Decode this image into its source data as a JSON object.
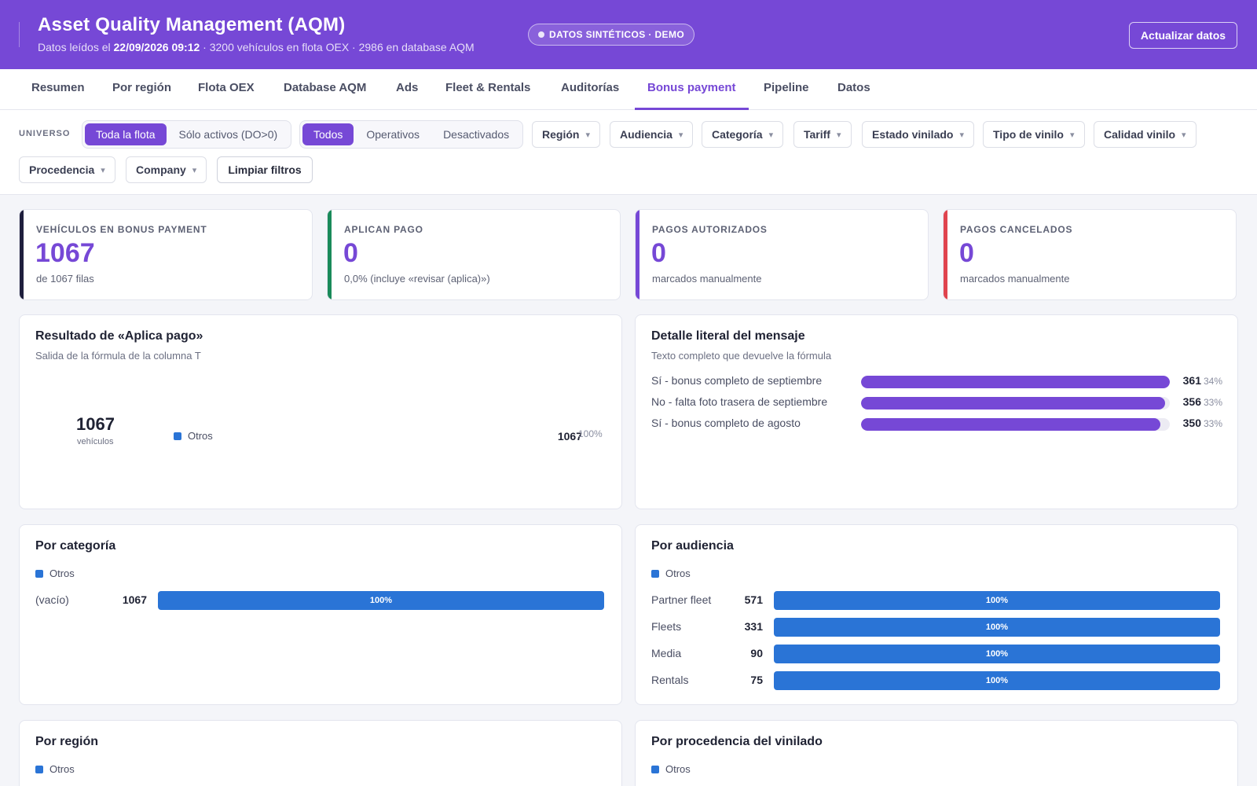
{
  "header": {
    "title": "Asset Quality Management (AQM)",
    "subtitle_prefix": "Datos leídos el",
    "subtitle_date": "22/09/2026 09:12",
    "subtitle_suffix": "· 3200 vehículos en flota OEX · 2986 en database AQM",
    "demo_badge": "DATOS SINTÉTICOS · DEMO",
    "refresh_button": "Actualizar datos"
  },
  "tabs": [
    {
      "label": "Resumen"
    },
    {
      "label": "Por región"
    },
    {
      "label": "Flota OEX"
    },
    {
      "label": "Database AQM"
    },
    {
      "label": "Ads"
    },
    {
      "label": "Fleet & Rentals"
    },
    {
      "label": "Auditorías"
    },
    {
      "label": "Bonus payment",
      "active": true
    },
    {
      "label": "Pipeline"
    },
    {
      "label": "Datos"
    }
  ],
  "filters": {
    "universe_label": "UNIVERSO",
    "universe_options": [
      "Toda la flota",
      "Sólo activos (DO>0)"
    ],
    "universe_selected": "Toda la flota",
    "status_options": [
      "Todos",
      "Operativos",
      "Desactivados"
    ],
    "status_selected": "Todos",
    "dropdowns": [
      "Región",
      "Audiencia",
      "Categoría",
      "Tariff",
      "Estado vinilado",
      "Tipo de vinilo",
      "Calidad vinilo",
      "Procedencia",
      "Company"
    ],
    "clear_button": "Limpiar filtros",
    "caret": "▾"
  },
  "kpis": [
    {
      "label": "VEHÍCULOS EN BONUS PAYMENT",
      "value": "1067",
      "sub": "de 1067 filas",
      "accent": "#1f1f3d"
    },
    {
      "label": "APLICAN PAGO",
      "value": "0",
      "sub": "0,0% (incluye «revisar (aplica)»)",
      "accent": "#1a8a5a"
    },
    {
      "label": "PAGOS AUTORIZADOS",
      "value": "0",
      "sub": "marcados manualmente",
      "accent": "#7648d6"
    },
    {
      "label": "PAGOS CANCELADOS",
      "value": "0",
      "sub": "marcados manualmente",
      "accent": "#e0444e"
    }
  ],
  "aplica_pago": {
    "title": "Resultado de «Aplica pago»",
    "subtitle": "Salida de la fórmula de la columna T",
    "total": "1067",
    "total_label": "vehículos",
    "rows": [
      {
        "label": "Otros",
        "count": "1067",
        "pct": "100%",
        "fraction": 1.0
      }
    ]
  },
  "mensaje": {
    "title": "Detalle literal del mensaje",
    "subtitle": "Texto completo que devuelve la fórmula",
    "rows": [
      {
        "label": "Sí - bonus completo de septiembre",
        "count": "361",
        "pct": "34%",
        "fraction": 1.0
      },
      {
        "label": "No - falta foto trasera de septiembre",
        "count": "356",
        "pct": "33%",
        "fraction": 0.986
      },
      {
        "label": "Sí - bonus completo de agosto",
        "count": "350",
        "pct": "33%",
        "fraction": 0.97
      }
    ]
  },
  "categoria": {
    "title": "Por categoría",
    "legend": "Otros",
    "rows": [
      {
        "label": "(vacío)",
        "count": "1067",
        "pct": "100%"
      }
    ]
  },
  "audiencia": {
    "title": "Por audiencia",
    "legend": "Otros",
    "rows": [
      {
        "label": "Partner fleet",
        "count": "571",
        "pct": "100%"
      },
      {
        "label": "Fleets",
        "count": "331",
        "pct": "100%"
      },
      {
        "label": "Media",
        "count": "90",
        "pct": "100%"
      },
      {
        "label": "Rentals",
        "count": "75",
        "pct": "100%"
      }
    ]
  },
  "region": {
    "title": "Por región",
    "legend": "Otros"
  },
  "procedencia": {
    "title": "Por procedencia del vinilado",
    "legend": "Otros"
  },
  "colors": {
    "brand": "#7648d6",
    "series_blue": "#2a74d6"
  }
}
